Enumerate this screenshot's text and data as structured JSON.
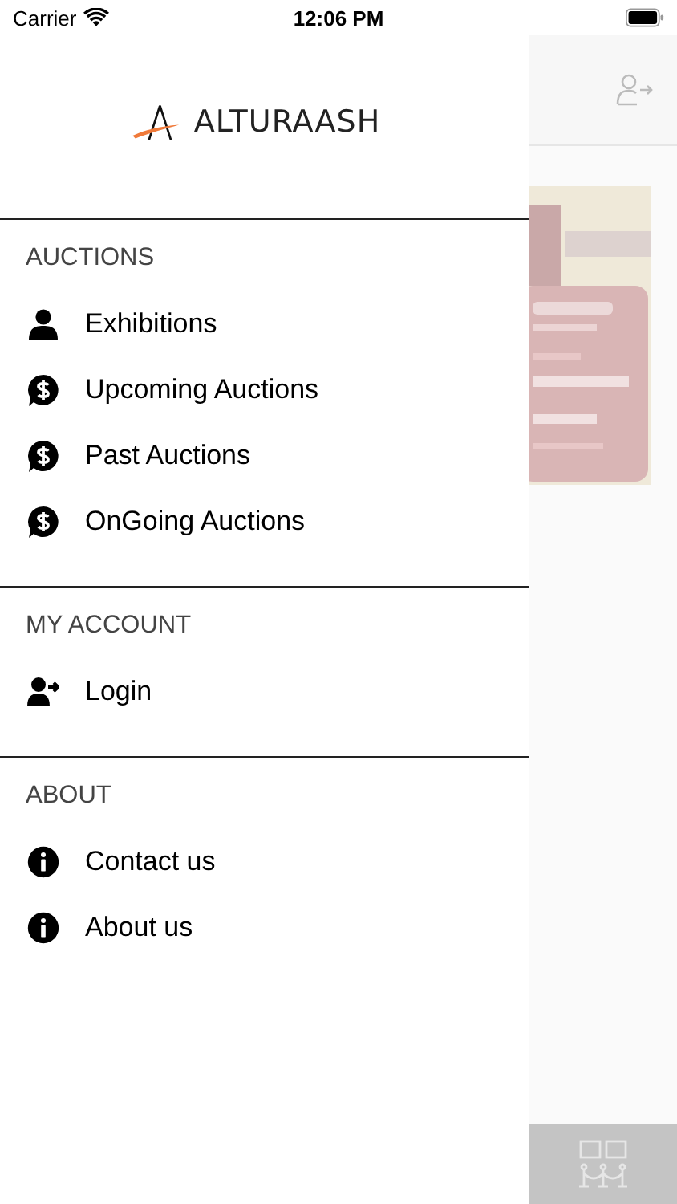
{
  "status_bar": {
    "carrier": "Carrier",
    "time": "12:06 PM"
  },
  "logo": {
    "text": "ALTURAASH"
  },
  "sections": [
    {
      "title": "AUCTIONS",
      "items": [
        {
          "label": "Exhibitions",
          "kind": "person"
        },
        {
          "label": "Upcoming Auctions",
          "kind": "dollar"
        },
        {
          "label": "Past Auctions",
          "kind": "dollar"
        },
        {
          "label": "OnGoing Auctions",
          "kind": "dollar"
        }
      ]
    },
    {
      "title": "MY ACCOUNT",
      "items": [
        {
          "label": "Login",
          "kind": "login"
        }
      ]
    },
    {
      "title": "ABOUT",
      "items": [
        {
          "label": "Contact us",
          "kind": "info"
        },
        {
          "label": "About us",
          "kind": "info"
        }
      ]
    }
  ]
}
